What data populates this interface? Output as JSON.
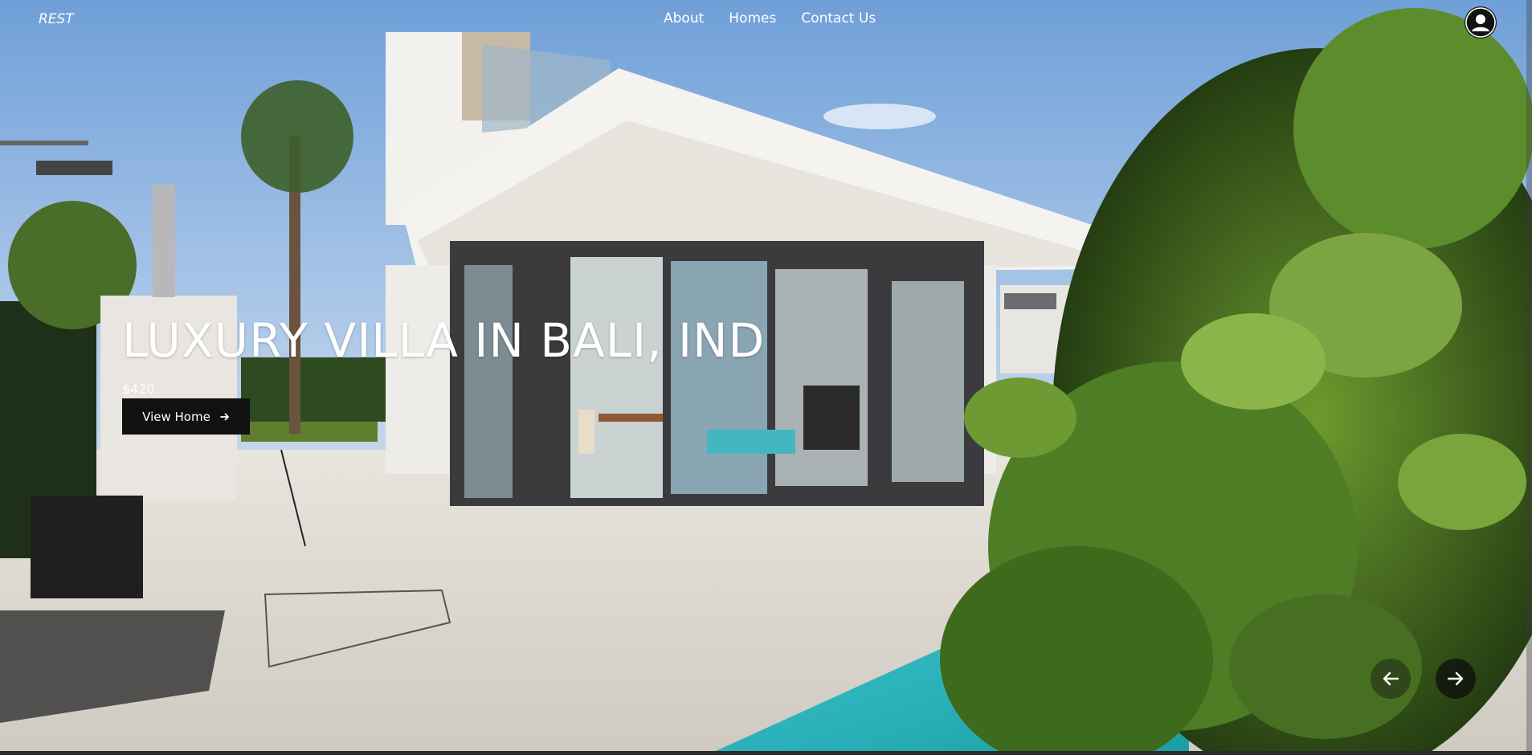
{
  "nav": {
    "logo": "REST",
    "links": [
      "About",
      "Homes",
      "Contact Us"
    ]
  },
  "hero": {
    "title": "LUXURY VILLA IN BALI, IND",
    "price": "$420",
    "cta_label": "View Home"
  },
  "icons": {
    "avatar": "user-avatar-icon",
    "cta_arrow": "arrow-right-icon",
    "prev": "arrow-left-icon",
    "next": "arrow-right-icon"
  },
  "colors": {
    "sky": "#7FA8DA",
    "button": "#111111",
    "text": "#FFFFFF"
  }
}
